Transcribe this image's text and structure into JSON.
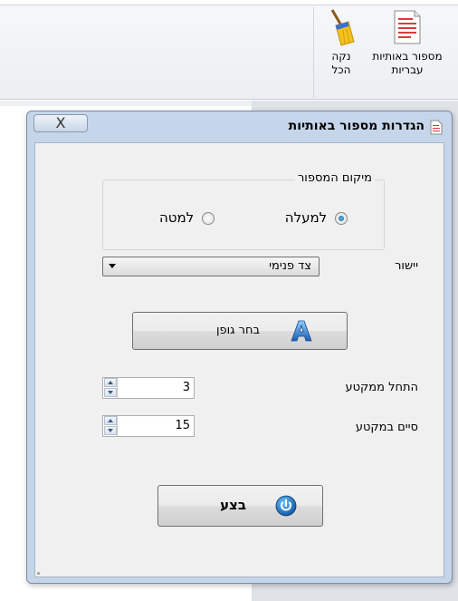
{
  "ribbon": {
    "clean_all": {
      "label": "נקה הכל",
      "icon": "broom-icon"
    },
    "hebrew_numbering": {
      "label": "מספור באותיות עבריות",
      "icon": "document-icon"
    }
  },
  "dialog": {
    "title": "הגדרות מספור באותיות",
    "close_label": "X",
    "position_group": {
      "legend": "מיקום המספור",
      "options": [
        {
          "label": "למעלה",
          "checked": true
        },
        {
          "label": "למטה",
          "checked": false
        }
      ]
    },
    "alignment": {
      "label": "יישור",
      "selected": "צד פנימי"
    },
    "font_button": {
      "label": "בחר גופן",
      "icon": "font-a-icon"
    },
    "start_section": {
      "label": "התחל ממקטע",
      "value": "3"
    },
    "end_section": {
      "label": "סיים במקטע",
      "value": "15"
    },
    "execute_button": {
      "label": "בצע",
      "icon": "power-icon"
    }
  }
}
